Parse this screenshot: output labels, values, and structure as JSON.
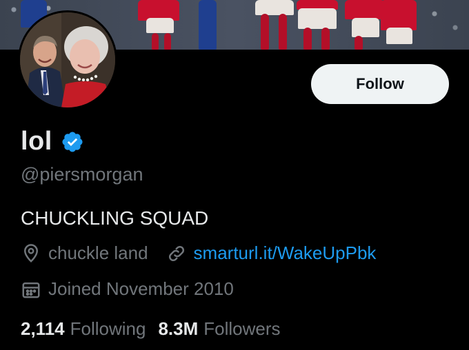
{
  "profile": {
    "display_name": "lol",
    "handle": "@piersmorgan",
    "bio": "CHUCKLING SQUAD",
    "location": "chuckle land",
    "website": "smarturl.it/WakeUpPbk",
    "joined": "Joined November 2010",
    "verified": true
  },
  "actions": {
    "follow_label": "Follow"
  },
  "stats": {
    "following_count": "2,114",
    "following_label": "Following",
    "followers_count": "8.3M",
    "followers_label": "Followers"
  },
  "colors": {
    "background": "#000000",
    "primary_text": "#e7e9ea",
    "secondary_text": "#71767b",
    "link": "#1d9bf0",
    "verified_badge": "#1d9bf0",
    "follow_button_bg": "#eff3f4"
  },
  "icons": {
    "verified": "verified-badge-icon",
    "location": "location-pin-icon",
    "link": "link-icon",
    "joined": "calendar-icon"
  }
}
